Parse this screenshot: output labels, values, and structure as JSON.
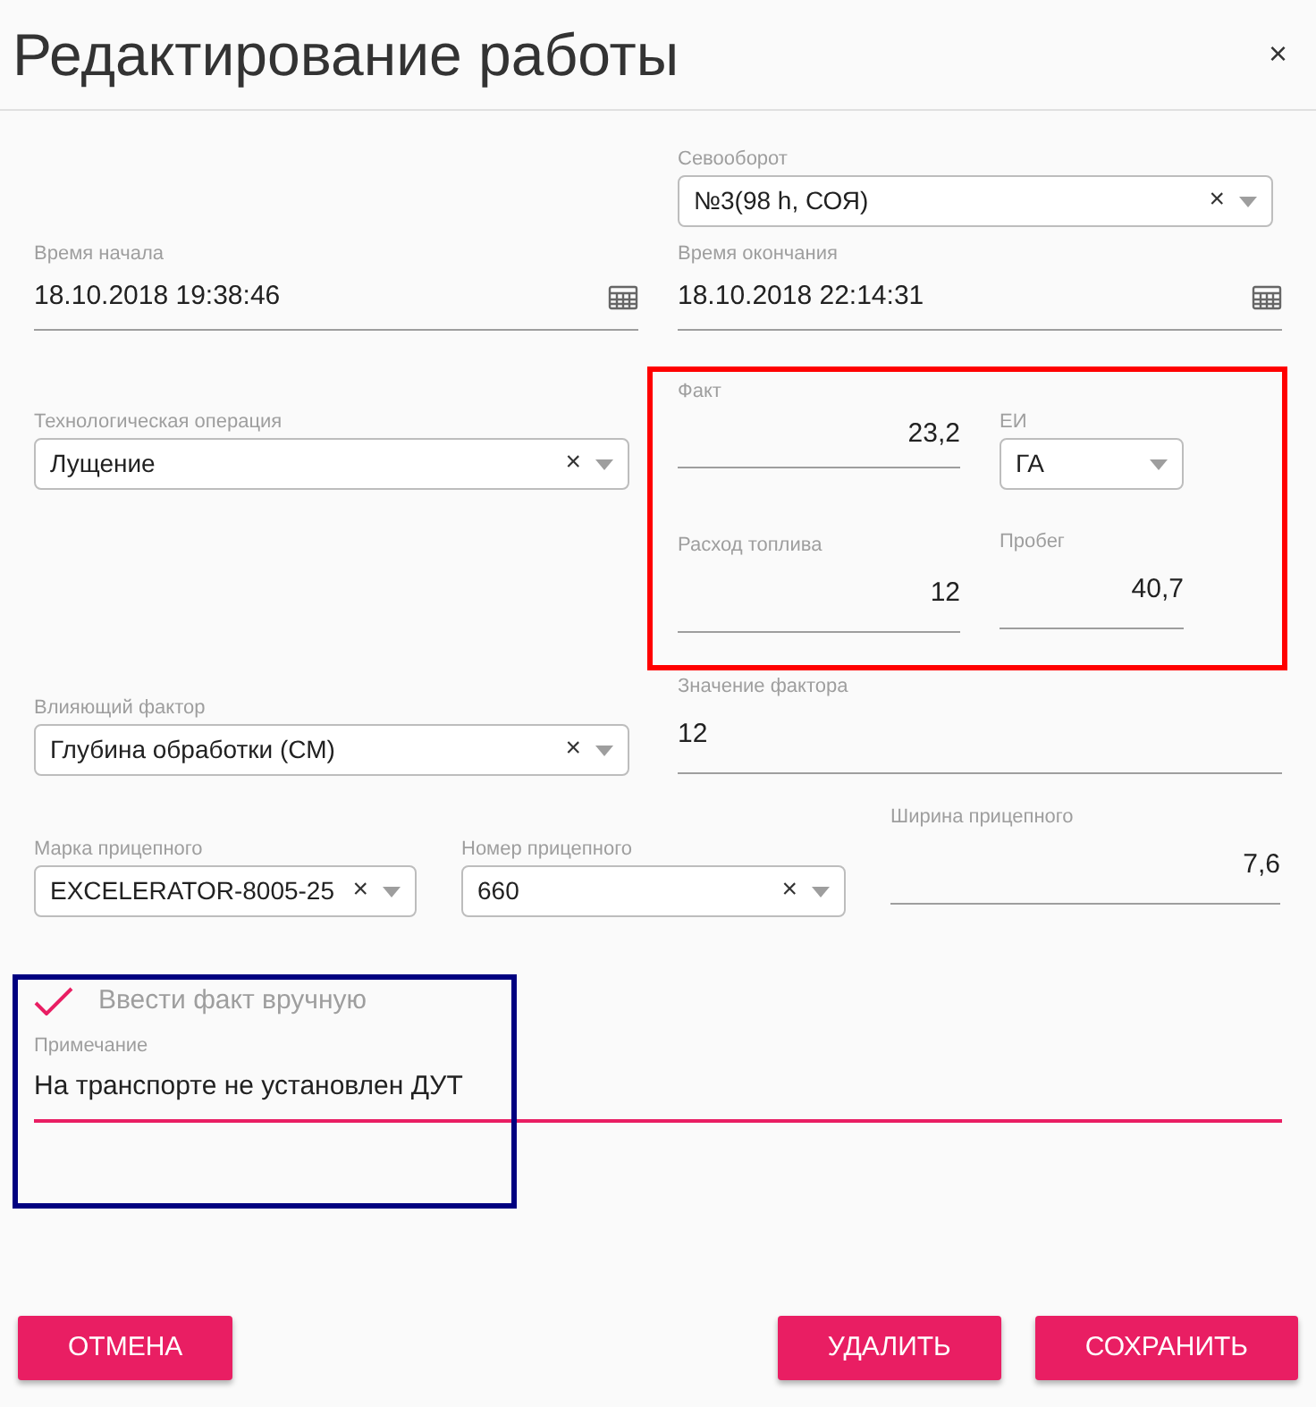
{
  "title": "Редактирование работы",
  "close": "×",
  "crop_rotation": {
    "label": "Севооборот",
    "value": "№3(98 h, СОЯ)",
    "clear": "×"
  },
  "start_time": {
    "label": "Время начала",
    "value": "18.10.2018 19:38:46"
  },
  "end_time": {
    "label": "Время окончания",
    "value": "18.10.2018 22:14:31"
  },
  "operation": {
    "label": "Технологическая операция",
    "value": "Лущение",
    "clear": "×"
  },
  "fact": {
    "label": "Факт",
    "value": "23,2"
  },
  "unit": {
    "label": "ЕИ",
    "value": "ГА"
  },
  "fuel": {
    "label": "Расход топлива",
    "value": "12"
  },
  "mileage": {
    "label": "Пробег",
    "value": "40,7"
  },
  "factor": {
    "label": "Влияющий фактор",
    "value": "Глубина обработки (СМ)",
    "clear": "×"
  },
  "factor_value": {
    "label": "Значение фактора",
    "value": "12"
  },
  "trailer_brand": {
    "label": "Марка прицепного",
    "value": "EXCELERATOR-8005-25",
    "clear": "×"
  },
  "trailer_number": {
    "label": "Номер прицепного",
    "value": "660",
    "clear": "×"
  },
  "trailer_width": {
    "label": "Ширина прицепного",
    "value": "7,6"
  },
  "manual": {
    "label": "Ввести факт вручную",
    "checked": true
  },
  "note": {
    "label": "Примечание",
    "value": "На транспорте не установлен ДУТ",
    "focused": true
  },
  "highlights": [
    {
      "color": "#ff0000"
    },
    {
      "color": "#000080"
    }
  ],
  "buttons": {
    "cancel": "ОТМЕНА",
    "delete": "УДАЛИТЬ",
    "save": "СОХРАНИТЬ"
  }
}
